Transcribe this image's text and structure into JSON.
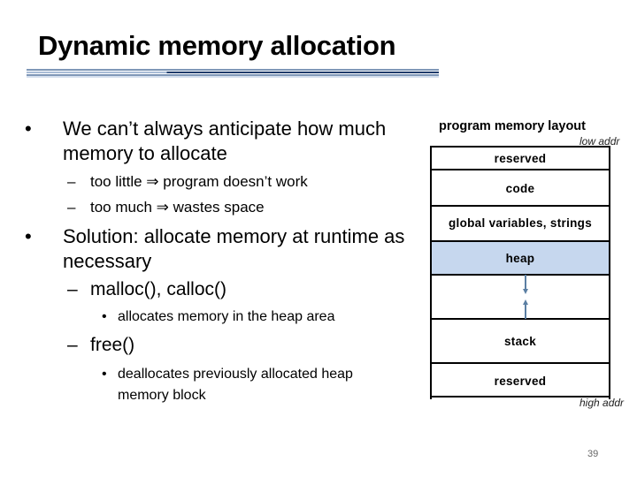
{
  "slide": {
    "title": "Dynamic memory allocation",
    "page_number": "39"
  },
  "body": {
    "bullet1": {
      "line1": "We can’t always anticipate how much",
      "line2": "memory to allocate",
      "sub": [
        "too little ⇒ program doesn’t work",
        "too much ⇒ wastes space"
      ]
    },
    "bullet2": {
      "line1": "Solution: allocate memory at runtime as",
      "line2": "necessary",
      "sub1": {
        "label": "malloc(), calloc()",
        "detail": "allocates memory in the heap area"
      },
      "sub2": {
        "label": "free()",
        "detail_line1": "deallocates previously allocated heap",
        "detail_line2": "memory block"
      }
    },
    "bullet_glyph": "•",
    "dash_glyph": "–"
  },
  "diagram": {
    "title": "program memory layout",
    "low_addr": "low addr",
    "high_addr": "high addr",
    "segments": [
      "reserved",
      "code",
      "global variables, strings",
      "heap",
      "",
      "stack",
      "reserved"
    ],
    "heap_color": "#c6d7ee",
    "arrow_color": "#5b7fa3"
  }
}
